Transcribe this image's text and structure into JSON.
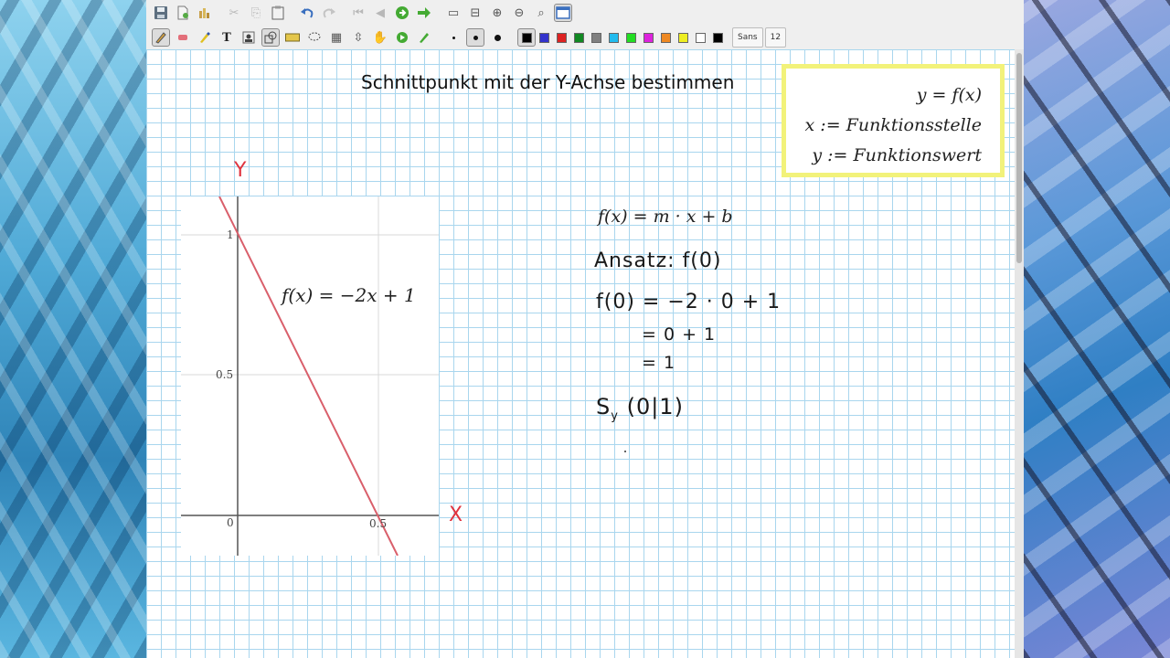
{
  "toolbar": {
    "font_name": "Sans",
    "font_size": "12",
    "colors": [
      "#000000",
      "#3333cc",
      "#dd2222",
      "#118822",
      "#808080",
      "#22bbee",
      "#22dd22",
      "#dd22dd",
      "#ee8822",
      "#eeee22",
      "#ffffff",
      "#000000"
    ]
  },
  "page": {
    "title": "Schnittpunkt mit der Y-Achse bestimmen"
  },
  "definition_box": {
    "line1": "y = f(x)",
    "line2": "x := Funktionsstelle",
    "line3": "y := Funktionswert"
  },
  "graph": {
    "y_axis_label": "Y",
    "x_axis_label": "X",
    "function_label": "f(x) = −2x + 1",
    "tick_y_1": "1",
    "tick_y_05": "0.5",
    "tick_origin": "0",
    "tick_x_05": "0.5",
    "line_color": "#d95f6b"
  },
  "notes": {
    "formula": "f(x) = m · x + b",
    "ansatz": "Ansatz: f(0)",
    "step1": "f(0) = −2 · 0 + 1",
    "step2": "=   0 + 1",
    "step3": "= 1",
    "result_prefix": "S",
    "result_sub": "y",
    "result_rest": "(0|1)"
  }
}
